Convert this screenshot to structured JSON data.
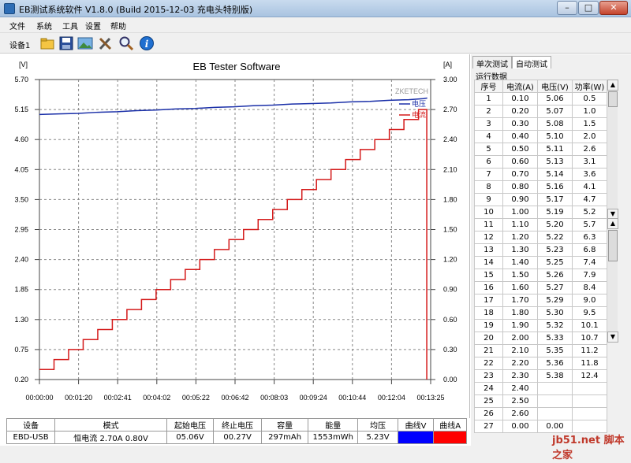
{
  "window": {
    "title": "EB测试系统软件 V1.8.0 (Build 2015-12-03 充电头特别版)",
    "minimize": "–",
    "maximize": "□",
    "close": "✕"
  },
  "menu": [
    "文件",
    "系统",
    "工具",
    "设置",
    "帮助"
  ],
  "toolbar": {
    "device_label": "设备1",
    "icons": [
      "folder-icon",
      "save-icon",
      "picture-icon",
      "tools-icon",
      "search-icon",
      "info-icon"
    ]
  },
  "chart_data": {
    "type": "line",
    "title": "EB Tester Software",
    "left_unit": "[V]",
    "right_unit": "[A]",
    "watermark": "ZKETECH",
    "left_ticks": [
      "5.70",
      "5.15",
      "4.60",
      "4.05",
      "3.50",
      "2.95",
      "2.40",
      "1.85",
      "1.30",
      "0.75",
      "0.20"
    ],
    "right_ticks": [
      "3.00",
      "2.70",
      "2.40",
      "2.10",
      "1.80",
      "1.50",
      "1.20",
      "0.90",
      "0.60",
      "0.30",
      "0.00"
    ],
    "x_ticks": [
      "00:00:00",
      "00:01:20",
      "00:02:41",
      "00:04:02",
      "00:05:22",
      "00:06:42",
      "00:08:03",
      "00:09:24",
      "00:10:44",
      "00:12:04",
      "00:13:25"
    ],
    "left_range": [
      0.2,
      5.7
    ],
    "right_range": [
      0.0,
      3.0
    ],
    "x_range_seconds": [
      0,
      805
    ],
    "legend": [
      {
        "name": "电压",
        "color": "#1a2fa8"
      },
      {
        "name": "电流",
        "color": "#d41a1a"
      }
    ],
    "series": [
      {
        "name": "电压",
        "axis": "left",
        "color": "#1a2fa8",
        "x": [
          0,
          40,
          80,
          120,
          160,
          200,
          240,
          280,
          320,
          360,
          400,
          440,
          480,
          520,
          560,
          600,
          640,
          680,
          720,
          760,
          790,
          798
        ],
        "values": [
          5.06,
          5.07,
          5.08,
          5.1,
          5.11,
          5.13,
          5.14,
          5.16,
          5.17,
          5.19,
          5.2,
          5.22,
          5.23,
          5.25,
          5.26,
          5.27,
          5.29,
          5.3,
          5.32,
          5.33,
          5.35,
          5.36
        ]
      },
      {
        "name": "电流",
        "axis": "right",
        "color": "#d41a1a",
        "step": true,
        "x": [
          0,
          30,
          60,
          90,
          120,
          150,
          180,
          210,
          240,
          270,
          300,
          330,
          360,
          390,
          420,
          450,
          480,
          510,
          540,
          570,
          600,
          630,
          660,
          690,
          720,
          750,
          780,
          797
        ],
        "values": [
          0.1,
          0.2,
          0.3,
          0.4,
          0.5,
          0.6,
          0.7,
          0.8,
          0.9,
          1.0,
          1.1,
          1.2,
          1.3,
          1.4,
          1.5,
          1.6,
          1.7,
          1.8,
          1.9,
          2.0,
          2.1,
          2.2,
          2.3,
          2.4,
          2.5,
          2.6,
          2.7,
          0.0
        ]
      }
    ]
  },
  "summary": {
    "headers": [
      "设备",
      "模式",
      "起始电压",
      "终止电压",
      "容量",
      "能量",
      "均压",
      "曲线V",
      "曲线A"
    ],
    "row": [
      "EBD-USB",
      "恒电流  2.70A  0.80V",
      "05.06V",
      "00.27V",
      "297mAh",
      "1553mWh",
      "5.23V"
    ],
    "curve_v_color": "#0000ff",
    "curve_a_color": "#ff0000"
  },
  "right_panel": {
    "tabs": [
      "单次测试",
      "自动测试"
    ],
    "active_tab": 1,
    "group_label": "运行数据",
    "columns": [
      "序号",
      "电流(A)",
      "电压(V)",
      "功率(W)"
    ],
    "upper_rows": [
      [
        "1",
        "0.10",
        "5.06",
        "0.5"
      ],
      [
        "2",
        "0.20",
        "5.07",
        "1.0"
      ],
      [
        "3",
        "0.30",
        "5.08",
        "1.5"
      ],
      [
        "4",
        "0.40",
        "5.10",
        "2.0"
      ],
      [
        "5",
        "0.50",
        "5.11",
        "2.6"
      ],
      [
        "6",
        "0.60",
        "5.13",
        "3.1"
      ],
      [
        "7",
        "0.70",
        "5.14",
        "3.6"
      ],
      [
        "8",
        "0.80",
        "5.16",
        "4.1"
      ],
      [
        "9",
        "0.90",
        "5.17",
        "4.7"
      ],
      [
        "10",
        "1.00",
        "5.19",
        "5.2"
      ]
    ],
    "lower_rows": [
      [
        "11",
        "1.10",
        "5.20",
        "5.7"
      ],
      [
        "12",
        "1.20",
        "5.22",
        "6.3"
      ],
      [
        "13",
        "1.30",
        "5.23",
        "6.8"
      ],
      [
        "14",
        "1.40",
        "5.25",
        "7.4"
      ],
      [
        "15",
        "1.50",
        "5.26",
        "7.9"
      ],
      [
        "16",
        "1.60",
        "5.27",
        "8.4"
      ],
      [
        "17",
        "1.70",
        "5.29",
        "9.0"
      ],
      [
        "18",
        "1.80",
        "5.30",
        "9.5"
      ],
      [
        "19",
        "1.90",
        "5.32",
        "10.1"
      ],
      [
        "20",
        "2.00",
        "5.33",
        "10.7"
      ],
      [
        "21",
        "2.10",
        "5.35",
        "11.2"
      ],
      [
        "22",
        "2.20",
        "5.36",
        "11.8"
      ],
      [
        "23",
        "2.30",
        "5.38",
        "12.4"
      ],
      [
        "24",
        "2.40",
        "",
        ""
      ],
      [
        "25",
        "2.50",
        "",
        ""
      ],
      [
        "26",
        "2.60",
        "",
        ""
      ],
      [
        "27",
        "0.00",
        "0.00",
        ""
      ]
    ]
  },
  "watermark_text": "jb51.net 脚本之家"
}
